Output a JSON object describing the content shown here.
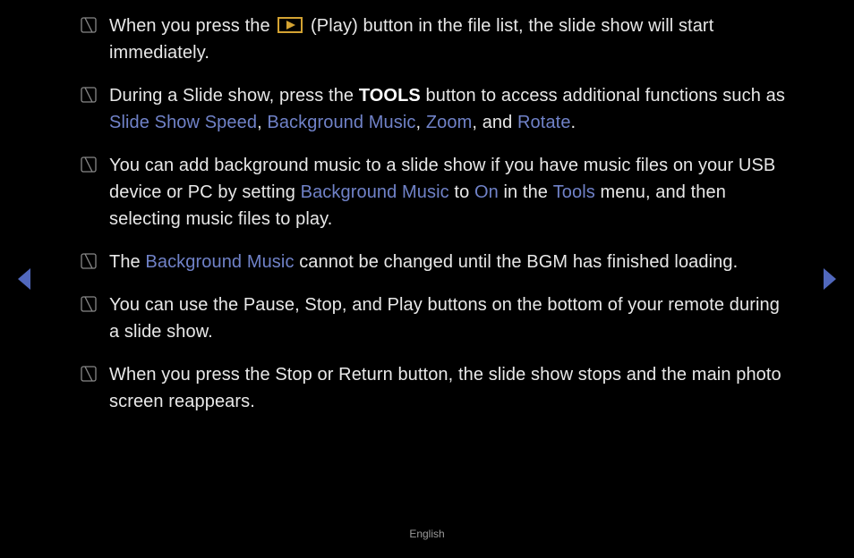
{
  "notes": [
    {
      "pre": "When you press the ",
      "play_label": "(Play)",
      "post": " button in the file list, the slide show will start immediately."
    },
    {
      "text_parts": {
        "a": "During a Slide show, press the ",
        "tools": "TOOLS",
        "b": " button to access additional functions such as ",
        "slide_show_speed": "Slide Show Speed",
        "c": ", ",
        "background_music": "Background Music",
        "d": ", ",
        "zoom": "Zoom",
        "e": ", and ",
        "rotate": "Rotate",
        "f": "."
      }
    },
    {
      "text_parts": {
        "a": "You can add background music to a slide show if you have music files on your USB device or PC by setting ",
        "background_music": "Background Music",
        "b": " to ",
        "on": "On",
        "c": " in the ",
        "tools": "Tools",
        "d": " menu, and then selecting music files to play."
      }
    },
    {
      "text_parts": {
        "a": "The ",
        "background_music": "Background Music",
        "b": " cannot be changed until the BGM has finished loading."
      }
    },
    {
      "text": "You can use the Pause, Stop, and Play buttons on the bottom of your remote during a slide show."
    },
    {
      "text": "When you press the Stop or Return button, the slide show stops and the main photo screen reappears."
    }
  ],
  "footer": "English"
}
